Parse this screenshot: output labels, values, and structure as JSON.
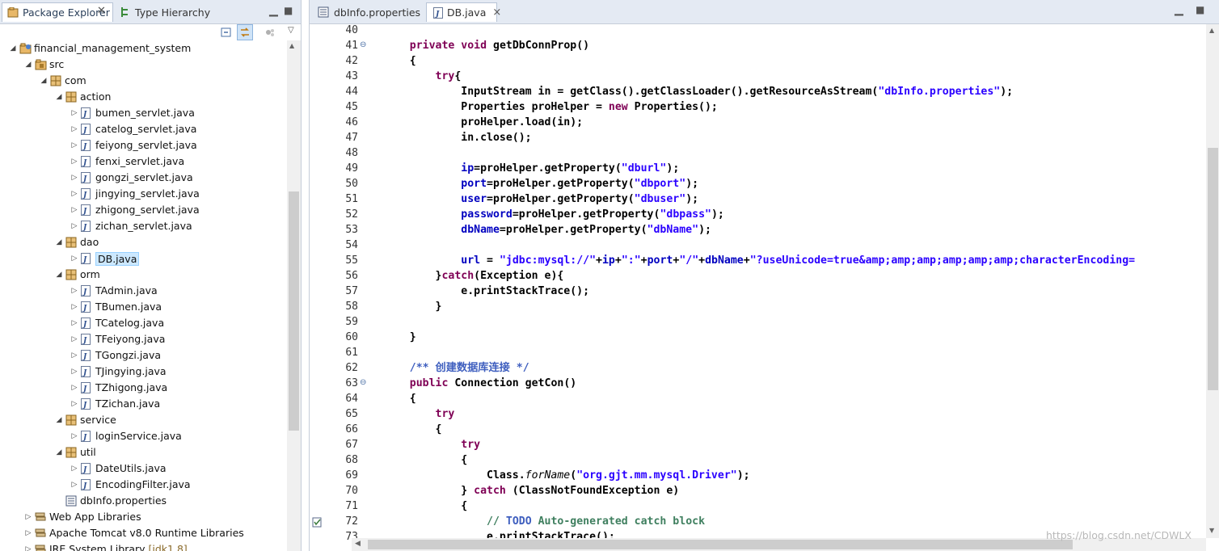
{
  "left_panel": {
    "tabs": [
      {
        "label": "Package Explorer",
        "icon": "package-explorer-icon"
      },
      {
        "label": "Type Hierarchy",
        "icon": "type-hierarchy-icon"
      }
    ],
    "tree": [
      {
        "label": "financial_management_system",
        "depth": 0,
        "icon": "project-icon",
        "expanded": true
      },
      {
        "label": "src",
        "depth": 1,
        "icon": "source-folder-icon",
        "expanded": true
      },
      {
        "label": "com",
        "depth": 2,
        "icon": "package-icon",
        "expanded": true
      },
      {
        "label": "action",
        "depth": 3,
        "icon": "package-icon",
        "expanded": true
      },
      {
        "label": "bumen_servlet.java",
        "depth": 4,
        "icon": "java-file-icon"
      },
      {
        "label": "catelog_servlet.java",
        "depth": 4,
        "icon": "java-file-icon"
      },
      {
        "label": "feiyong_servlet.java",
        "depth": 4,
        "icon": "java-file-icon"
      },
      {
        "label": "fenxi_servlet.java",
        "depth": 4,
        "icon": "java-file-icon"
      },
      {
        "label": "gongzi_servlet.java",
        "depth": 4,
        "icon": "java-file-icon"
      },
      {
        "label": "jingying_servlet.java",
        "depth": 4,
        "icon": "java-file-icon"
      },
      {
        "label": "zhigong_servlet.java",
        "depth": 4,
        "icon": "java-file-icon"
      },
      {
        "label": "zichan_servlet.java",
        "depth": 4,
        "icon": "java-file-icon"
      },
      {
        "label": "dao",
        "depth": 3,
        "icon": "package-icon",
        "expanded": true
      },
      {
        "label": "DB.java",
        "depth": 4,
        "icon": "java-file-icon",
        "selected": true
      },
      {
        "label": "orm",
        "depth": 3,
        "icon": "package-icon",
        "expanded": true
      },
      {
        "label": "TAdmin.java",
        "depth": 4,
        "icon": "java-file-icon"
      },
      {
        "label": "TBumen.java",
        "depth": 4,
        "icon": "java-file-icon"
      },
      {
        "label": "TCatelog.java",
        "depth": 4,
        "icon": "java-file-icon"
      },
      {
        "label": "TFeiyong.java",
        "depth": 4,
        "icon": "java-file-icon"
      },
      {
        "label": "TGongzi.java",
        "depth": 4,
        "icon": "java-file-icon"
      },
      {
        "label": "TJingying.java",
        "depth": 4,
        "icon": "java-file-icon"
      },
      {
        "label": "TZhigong.java",
        "depth": 4,
        "icon": "java-file-icon"
      },
      {
        "label": "TZichan.java",
        "depth": 4,
        "icon": "java-file-icon"
      },
      {
        "label": "service",
        "depth": 3,
        "icon": "package-icon",
        "expanded": true
      },
      {
        "label": "loginService.java",
        "depth": 4,
        "icon": "java-file-icon"
      },
      {
        "label": "util",
        "depth": 3,
        "icon": "package-icon",
        "expanded": true
      },
      {
        "label": "DateUtils.java",
        "depth": 4,
        "icon": "java-file-icon"
      },
      {
        "label": "EncodingFilter.java",
        "depth": 4,
        "icon": "java-file-icon"
      },
      {
        "label": "dbInfo.properties",
        "depth": 3,
        "icon": "properties-file-icon",
        "noTwisty": true
      },
      {
        "label": "Web App Libraries",
        "depth": 1,
        "icon": "library-icon",
        "expanded": false
      },
      {
        "label": "Apache Tomcat v8.0 Runtime Libraries",
        "depth": 1,
        "icon": "library-icon",
        "expanded": false
      },
      {
        "label": "JRE System Library",
        "suffix": "[jdk1.8]",
        "depth": 1,
        "icon": "library-icon",
        "expanded": false
      }
    ]
  },
  "editor": {
    "tabs": [
      {
        "label": "dbInfo.properties",
        "icon": "properties-file-icon",
        "active": false
      },
      {
        "label": "DB.java",
        "icon": "java-file-icon",
        "active": true,
        "close": "×"
      }
    ],
    "lines": [
      {
        "n": "40",
        "code": []
      },
      {
        "n": "41",
        "fold": true,
        "code": [
          [
            "    ",
            ""
          ],
          [
            "private",
            "kw"
          ],
          [
            " ",
            ""
          ],
          [
            "void",
            "kw"
          ],
          [
            " getDbConnProp()",
            ""
          ]
        ]
      },
      {
        "n": "42",
        "code": [
          [
            "    {",
            ""
          ]
        ]
      },
      {
        "n": "43",
        "code": [
          [
            "        ",
            ""
          ],
          [
            "try",
            "kw"
          ],
          [
            "{",
            ""
          ]
        ]
      },
      {
        "n": "44",
        "code": [
          [
            "            InputStream in = getClass().getClassLoader().getResourceAsStream(",
            ""
          ],
          [
            "\"dbInfo.properties\"",
            "str"
          ],
          [
            ");",
            ""
          ]
        ]
      },
      {
        "n": "45",
        "code": [
          [
            "            Properties proHelper = ",
            ""
          ],
          [
            "new",
            "kw"
          ],
          [
            " Properties();",
            ""
          ]
        ]
      },
      {
        "n": "46",
        "code": [
          [
            "            proHelper.load(in);",
            ""
          ]
        ]
      },
      {
        "n": "47",
        "code": [
          [
            "            in.close();",
            ""
          ]
        ]
      },
      {
        "n": "48",
        "code": []
      },
      {
        "n": "49",
        "code": [
          [
            "            ",
            ""
          ],
          [
            "ip",
            "fld"
          ],
          [
            "=proHelper.getProperty(",
            ""
          ],
          [
            "\"dburl\"",
            "str"
          ],
          [
            ");",
            ""
          ]
        ]
      },
      {
        "n": "50",
        "code": [
          [
            "            ",
            ""
          ],
          [
            "port",
            "fld"
          ],
          [
            "=proHelper.getProperty(",
            ""
          ],
          [
            "\"dbport\"",
            "str"
          ],
          [
            ");",
            ""
          ]
        ]
      },
      {
        "n": "51",
        "code": [
          [
            "            ",
            ""
          ],
          [
            "user",
            "fld"
          ],
          [
            "=proHelper.getProperty(",
            ""
          ],
          [
            "\"dbuser\"",
            "str"
          ],
          [
            ");",
            ""
          ]
        ]
      },
      {
        "n": "52",
        "code": [
          [
            "            ",
            ""
          ],
          [
            "password",
            "fld"
          ],
          [
            "=proHelper.getProperty(",
            ""
          ],
          [
            "\"dbpass\"",
            "str"
          ],
          [
            ");",
            ""
          ]
        ]
      },
      {
        "n": "53",
        "code": [
          [
            "            ",
            ""
          ],
          [
            "dbName",
            "fld"
          ],
          [
            "=proHelper.getProperty(",
            ""
          ],
          [
            "\"dbName\"",
            "str"
          ],
          [
            ");",
            ""
          ]
        ]
      },
      {
        "n": "54",
        "code": []
      },
      {
        "n": "55",
        "code": [
          [
            "            ",
            ""
          ],
          [
            "url",
            "fld"
          ],
          [
            " = ",
            ""
          ],
          [
            "\"jdbc:mysql://\"",
            "str"
          ],
          [
            "+",
            ""
          ],
          [
            "ip",
            "fld"
          ],
          [
            "+",
            ""
          ],
          [
            "\":\"",
            "str"
          ],
          [
            "+",
            ""
          ],
          [
            "port",
            "fld"
          ],
          [
            "+",
            ""
          ],
          [
            "\"/\"",
            "str"
          ],
          [
            "+",
            ""
          ],
          [
            "dbName",
            "fld"
          ],
          [
            "+",
            ""
          ],
          [
            "\"?useUnicode=true&amp;amp;amp;amp;amp;amp;characterEncoding=",
            "str"
          ]
        ]
      },
      {
        "n": "56",
        "code": [
          [
            "        }",
            ""
          ],
          [
            "catch",
            "kw"
          ],
          [
            "(Exception e){",
            ""
          ]
        ]
      },
      {
        "n": "57",
        "code": [
          [
            "            e.printStackTrace();",
            ""
          ]
        ]
      },
      {
        "n": "58",
        "code": [
          [
            "        }",
            ""
          ]
        ]
      },
      {
        "n": "59",
        "code": []
      },
      {
        "n": "60",
        "code": [
          [
            "    }",
            ""
          ]
        ]
      },
      {
        "n": "61",
        "code": []
      },
      {
        "n": "62",
        "code": [
          [
            "    ",
            ""
          ],
          [
            "/** 创建数据库连接 */",
            "jdoc"
          ]
        ]
      },
      {
        "n": "63",
        "fold": true,
        "code": [
          [
            "    ",
            ""
          ],
          [
            "public",
            "kw"
          ],
          [
            " Connection getCon()",
            ""
          ]
        ]
      },
      {
        "n": "64",
        "code": [
          [
            "    {",
            ""
          ]
        ]
      },
      {
        "n": "65",
        "code": [
          [
            "        ",
            ""
          ],
          [
            "try",
            "kw"
          ]
        ]
      },
      {
        "n": "66",
        "code": [
          [
            "        {",
            ""
          ]
        ]
      },
      {
        "n": "67",
        "code": [
          [
            "            ",
            ""
          ],
          [
            "try",
            "kw"
          ]
        ]
      },
      {
        "n": "68",
        "code": [
          [
            "            {",
            ""
          ]
        ]
      },
      {
        "n": "69",
        "code": [
          [
            "                Class.",
            ""
          ],
          [
            "forName",
            "it"
          ],
          [
            "(",
            ""
          ],
          [
            "\"org.gjt.mm.mysql.Driver\"",
            "str"
          ],
          [
            ");",
            ""
          ]
        ]
      },
      {
        "n": "70",
        "code": [
          [
            "            } ",
            ""
          ],
          [
            "catch",
            "kw"
          ],
          [
            " (ClassNotFoundException e)",
            ""
          ]
        ]
      },
      {
        "n": "71",
        "code": [
          [
            "            {",
            ""
          ]
        ]
      },
      {
        "n": "72",
        "task": true,
        "code": [
          [
            "                ",
            ""
          ],
          [
            "// ",
            "com"
          ],
          [
            "TODO",
            "jdoc"
          ],
          [
            " Auto-generated catch block",
            "com"
          ]
        ]
      },
      {
        "n": "73",
        "code": [
          [
            "                e.printStackTrace();",
            ""
          ]
        ]
      }
    ]
  },
  "watermark": "https://blog.csdn.net/CDWLX",
  "colors": {
    "keyword": "#7f0055",
    "string": "#2a00ff",
    "field": "#0000c0",
    "comment": "#3f7f5f",
    "javadoc": "#3f5fbf"
  }
}
